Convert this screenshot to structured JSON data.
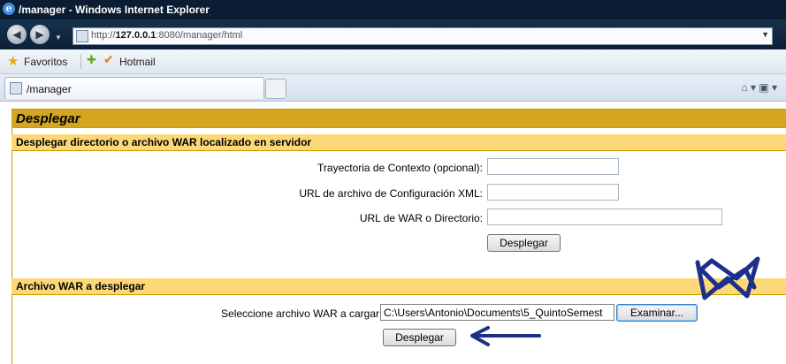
{
  "browser": {
    "window_title": "/manager - Windows Internet Explorer",
    "address": {
      "prefix": "http://",
      "host": "127.0.0.1",
      "rest": ":8080/manager/html"
    },
    "favorites_label": "Favoritos",
    "favorite_link": "Hotmail",
    "tab_title": "/manager"
  },
  "deploy": {
    "title": "Desplegar",
    "server_section": {
      "heading": "Desplegar directorio o archivo WAR localizado en servidor",
      "context_path_label": "Trayectoria de Contexto (opcional):",
      "context_path_value": "",
      "config_url_label": "URL de archivo de Configuración XML:",
      "config_url_value": "",
      "war_url_label": "URL de WAR o Directorio:",
      "war_url_value": "",
      "deploy_button": "Desplegar"
    },
    "upload_section": {
      "heading": "Archivo WAR a desplegar",
      "select_label": "Seleccione archivo WAR a cargar",
      "file_value": "C:\\Users\\Antonio\\Documents\\5_QuintoSemest",
      "browse_button": "Examinar...",
      "deploy_button": "Desplegar"
    }
  },
  "colors": {
    "title_bar": "#d4a51f",
    "subtitle_bar": "#fcd879",
    "annotation": "#1c2f8a"
  }
}
